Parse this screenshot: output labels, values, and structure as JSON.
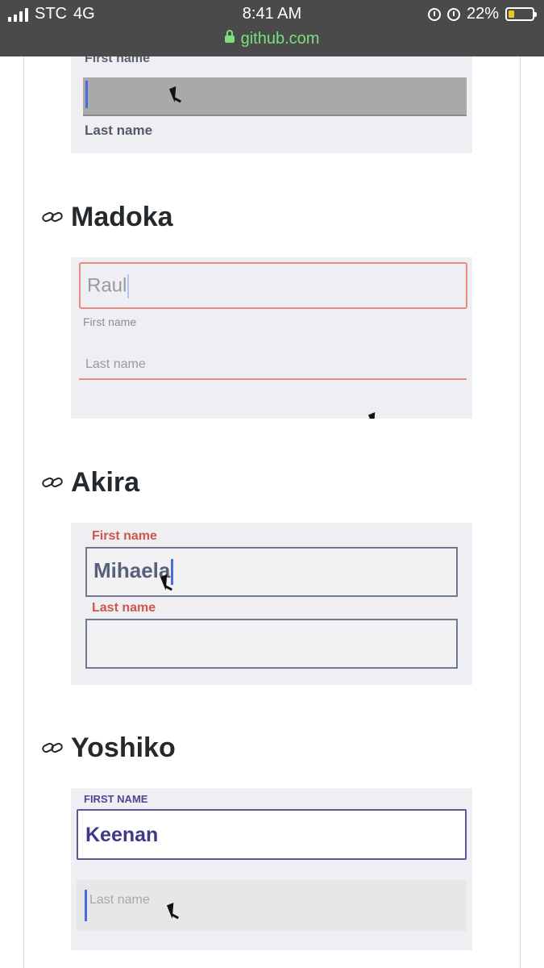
{
  "status_bar": {
    "carrier": "STC",
    "network": "4G",
    "time": "8:41 AM",
    "url": "github.com",
    "battery_percent": "22%",
    "battery_level": 0.22,
    "icons": [
      "cellular-signal-icon",
      "alarm-icon",
      "rotation-lock-icon",
      "battery-icon",
      "lock-icon"
    ],
    "url_color": "#7be07a"
  },
  "page": {
    "section1": {
      "top_label": "First name",
      "bottom_label": "Last name"
    },
    "section2": {
      "title": "Madoka",
      "first_value": "Raul",
      "first_label": "First name",
      "last_label": "Last name",
      "accent": "#e98a80"
    },
    "section3": {
      "title": "Akira",
      "first_label": "First name",
      "first_value": "Mihaela",
      "last_label": "Last name",
      "label_color": "#d0554a"
    },
    "section4": {
      "title": "Yoshiko",
      "first_label": "FIRST NAME",
      "first_value": "Keenan",
      "last_placeholder": "Last name",
      "accent": "#4b4794"
    }
  }
}
